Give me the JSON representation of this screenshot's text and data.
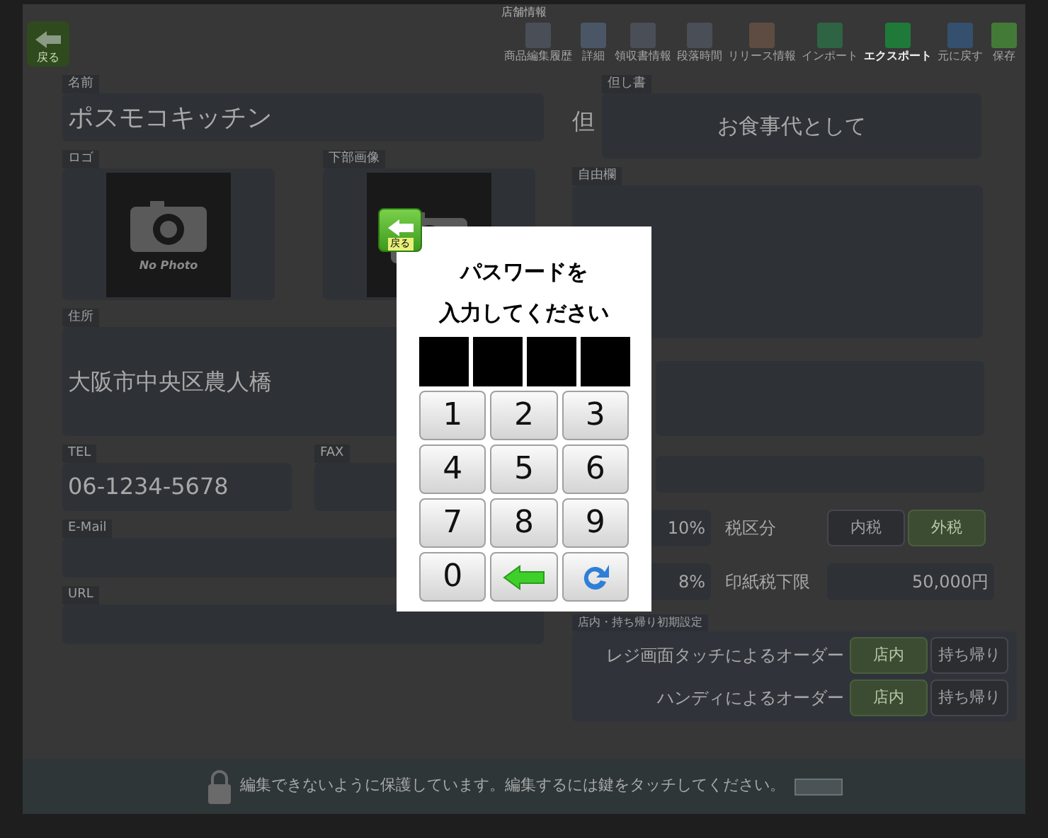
{
  "window": {
    "title": "店舗情報"
  },
  "toolbar": {
    "back": "戻る",
    "items": [
      {
        "label": "商品編集履歴",
        "selected": false
      },
      {
        "label": "詳細",
        "selected": false
      },
      {
        "label": "領収書情報",
        "selected": false
      },
      {
        "label": "段落時間",
        "selected": false
      },
      {
        "label": "リリース情報",
        "selected": false
      },
      {
        "label": "インポート",
        "selected": false
      },
      {
        "label": "エクスポート",
        "selected": true
      },
      {
        "label": "元に戻す",
        "selected": false
      },
      {
        "label": "保存",
        "selected": false
      }
    ]
  },
  "left": {
    "name": {
      "label": "名前",
      "value": "ポスモコキッチン"
    },
    "images": [
      {
        "label": "ロゴ",
        "placeholder": "No Photo"
      },
      {
        "label": "下部画像"
      }
    ],
    "address": {
      "label": "住所",
      "value": "大阪市中央区農人橋"
    },
    "tel": {
      "label": "TEL",
      "value": "06-1234-5678"
    },
    "fax": {
      "label": "FAX"
    },
    "email": {
      "label": "E-Mail"
    },
    "url": {
      "label": "URL"
    }
  },
  "right": {
    "receipt_note": {
      "prefix": "但",
      "label": "但し書",
      "value": "お食事代として"
    },
    "free_text": {
      "label": "自由欄"
    },
    "tax_rows": [
      {
        "rate": "10%",
        "label": "税区分",
        "kind": "choice",
        "options": [
          {
            "label": "内税",
            "selected": false
          },
          {
            "label": "外税",
            "selected": true
          }
        ]
      },
      {
        "rate": "8%",
        "label": "印紙税下限",
        "kind": "value",
        "value": "50,000円"
      }
    ],
    "order_defaults": {
      "label": "店内・持ち帰り初期設定",
      "rows": [
        {
          "label": "レジ画面タッチによるオーダー",
          "options": [
            {
              "label": "店内",
              "selected": true
            },
            {
              "label": "持ち帰り",
              "selected": false
            }
          ]
        },
        {
          "label": "ハンディによるオーダー",
          "options": [
            {
              "label": "店内",
              "selected": true
            },
            {
              "label": "持ち帰り",
              "selected": false
            }
          ]
        }
      ]
    }
  },
  "lock_bar": {
    "message": "編集できないように保護しています。編集するには鍵をタッチしてください。"
  },
  "password_dialog": {
    "back": "戻る",
    "title": [
      "パスワードを",
      "入力してください"
    ],
    "keys": [
      {
        "kind": "digit",
        "label": "1"
      },
      {
        "kind": "digit",
        "label": "2"
      },
      {
        "kind": "digit",
        "label": "3"
      },
      {
        "kind": "digit",
        "label": "4"
      },
      {
        "kind": "digit",
        "label": "5"
      },
      {
        "kind": "digit",
        "label": "6"
      },
      {
        "kind": "digit",
        "label": "7"
      },
      {
        "kind": "digit",
        "label": "8"
      },
      {
        "kind": "digit",
        "label": "9"
      },
      {
        "kind": "digit",
        "label": "0"
      },
      {
        "kind": "backspace"
      },
      {
        "kind": "refresh"
      }
    ]
  }
}
